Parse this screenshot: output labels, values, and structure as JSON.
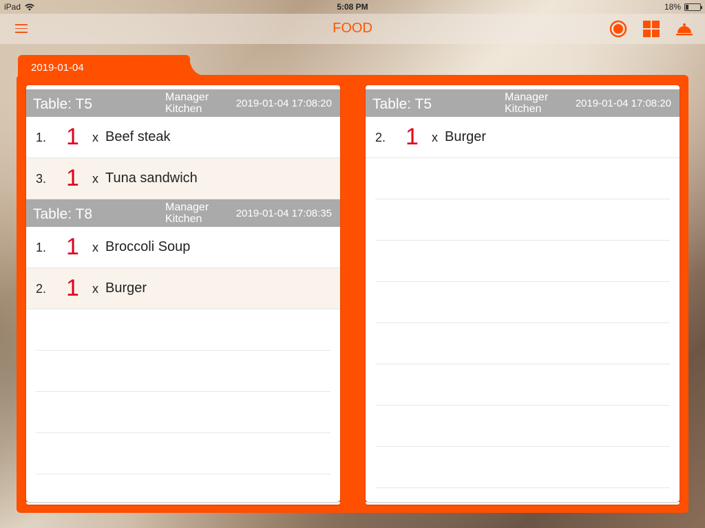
{
  "status_bar": {
    "device": "iPad",
    "time": "5:08 PM",
    "battery": "18%",
    "battery_level": 0.18
  },
  "nav": {
    "title": "FOOD",
    "icons": [
      "menu-icon",
      "record-icon",
      "grid-icon",
      "service-bell-icon"
    ]
  },
  "folder": {
    "date": "2019-01-04",
    "accent_color": "#ff4f00"
  },
  "left_panel": {
    "orders": [
      {
        "table": "Table: T5",
        "staff_line1": "Manager",
        "staff_line2": "Kitchen",
        "timestamp": "2019-01-04 17:08:20",
        "items": [
          {
            "num": "1.",
            "qty": "1",
            "x": "x",
            "name": "Beef steak"
          },
          {
            "num": "3.",
            "qty": "1",
            "x": "x",
            "name": "Tuna sandwich"
          }
        ]
      },
      {
        "table": "Table: T8",
        "staff_line1": "Manager",
        "staff_line2": "Kitchen",
        "timestamp": "2019-01-04 17:08:35",
        "items": [
          {
            "num": "1.",
            "qty": "1",
            "x": "x",
            "name": "Broccoli Soup"
          },
          {
            "num": "2.",
            "qty": "1",
            "x": "x",
            "name": "Burger"
          }
        ]
      }
    ]
  },
  "right_panel": {
    "orders": [
      {
        "table": "Table: T5",
        "staff_line1": "Manager",
        "staff_line2": "Kitchen",
        "timestamp": "2019-01-04 17:08:20",
        "items": [
          {
            "num": "2.",
            "qty": "1",
            "x": "x",
            "name": "Burger"
          }
        ]
      }
    ]
  }
}
